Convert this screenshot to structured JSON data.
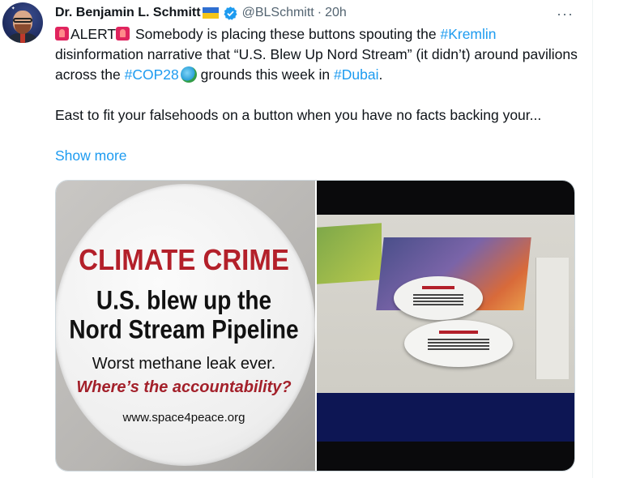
{
  "tweet": {
    "author": {
      "display_name": "Dr. Benjamin L. Schmitt",
      "handle": "@BLSchmitt",
      "separator": "·",
      "time": "20h",
      "verified": true
    },
    "more_icon": "···",
    "lines": {
      "alert": "ALERT",
      "p1a": " Somebody is placing these buttons spouting the ",
      "h_kremlin": "#Kremlin",
      "p1b": " disinformation narrative that “U.S. Blew Up Nord Stream” (it didn’t) around pavilions across the ",
      "h_cop28": "#COP28",
      "p1c": " grounds this week in ",
      "h_dubai": "#Dubai",
      "p1d": ".",
      "p2": "East to fit your falsehoods on a button when you have no facts backing your..."
    },
    "show_more": "Show more",
    "colors": {
      "link": "#1d9bf0",
      "secondary": "#536471",
      "text": "#0f1419"
    }
  },
  "media": {
    "left_photo": {
      "line1": "CLIMATE CRIME",
      "line2": "U.S. blew up the",
      "line3": "Nord Stream Pipeline",
      "line4": "Worst methane leak ever.",
      "line5": "Where’s the accountability?",
      "line6": "www.space4peace.org"
    }
  }
}
